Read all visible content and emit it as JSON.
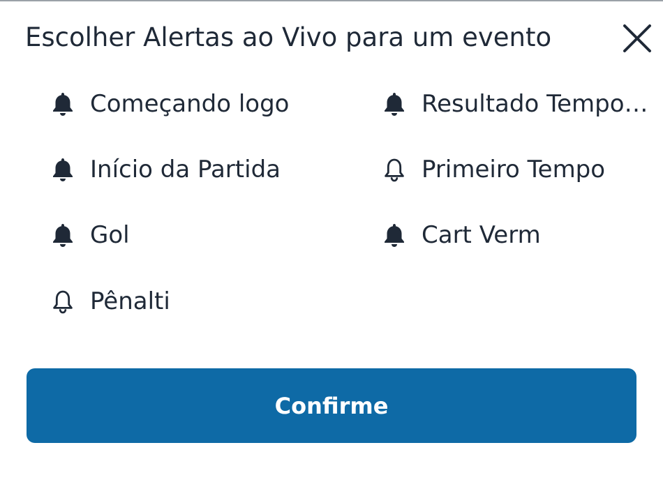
{
  "dialog": {
    "title": "Escolher Alertas ao Vivo para um evento",
    "close_icon": "close-icon",
    "confirm_label": "Confirme"
  },
  "alerts": {
    "left": [
      {
        "label": "Começando logo",
        "active": true
      },
      {
        "label": "Início da Partida",
        "active": true
      },
      {
        "label": "Gol",
        "active": true
      },
      {
        "label": "Pênalti",
        "active": false
      }
    ],
    "right": [
      {
        "label": "Resultado Tempo ...",
        "active": true
      },
      {
        "label": "Primeiro Tempo",
        "active": false
      },
      {
        "label": "Cart Verm",
        "active": true
      }
    ]
  },
  "colors": {
    "text": "#1f2937",
    "bell_filled": "#1f2937",
    "bell_outline": "#1f2937",
    "confirm_bg": "#0e6aa6",
    "confirm_text": "#ffffff"
  }
}
